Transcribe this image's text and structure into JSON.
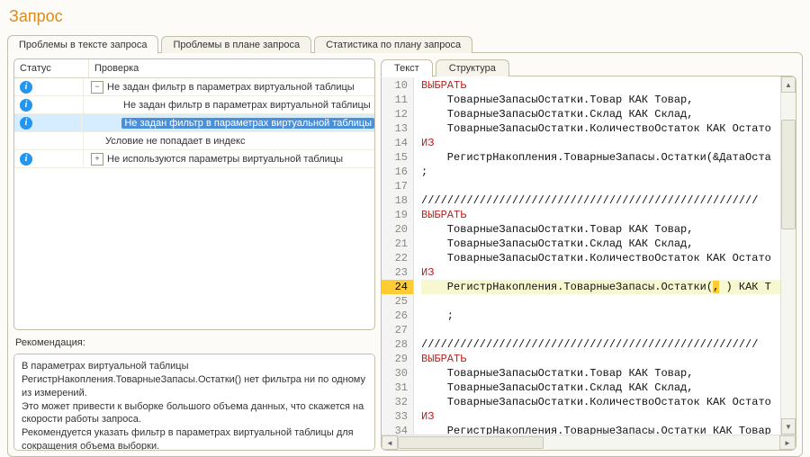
{
  "title": "Запрос",
  "main_tabs": [
    {
      "label": "Проблемы в тексте запроса",
      "active": true
    },
    {
      "label": "Проблемы в плане запроса",
      "active": false
    },
    {
      "label": "Статистика по плану запроса",
      "active": false
    }
  ],
  "tree": {
    "columns": {
      "status": "Статус",
      "check": "Проверка"
    },
    "rows": [
      {
        "icon": true,
        "indent": 0,
        "expander": "-",
        "label": "Не задан фильтр в параметрах виртуальной таблицы",
        "selected": false
      },
      {
        "icon": true,
        "indent": 1,
        "expander": "",
        "label": "Не задан фильтр в параметрах виртуальной таблицы",
        "selected": false
      },
      {
        "icon": true,
        "indent": 1,
        "expander": "",
        "label": "Не задан фильтр в параметрах виртуальной таблицы",
        "selected": true
      },
      {
        "icon": false,
        "indent": 0,
        "expander": "",
        "label": "Условие не попадает в индекс",
        "selected": false
      },
      {
        "icon": true,
        "indent": 0,
        "expander": "+",
        "label": "Не используются параметры виртуальной таблицы",
        "selected": false
      }
    ]
  },
  "recommendation_label": "Рекомендация:",
  "recommendation_text": "В параметрах виртуальной таблицы\nРегистрНакопления.ТоварныеЗапасы.Остатки() нет фильтра ни по одному из измерений.\nЭто может привести к выборке большого объема данных, что скажется на скорости работы запроса.\nРекомендуется указать фильтр в параметрах виртуальной таблицы для сокращения объема выборки.",
  "sub_tabs": [
    {
      "label": "Текст",
      "active": true
    },
    {
      "label": "Структура",
      "active": false
    }
  ],
  "code": {
    "first_line": 10,
    "highlight_line": 24,
    "lines": [
      {
        "n": 10,
        "t": "ВЫБРАТЬ",
        "kw": true
      },
      {
        "n": 11,
        "t": "    ТоварныеЗапасыОстатки.Товар КАК Товар,"
      },
      {
        "n": 12,
        "t": "    ТоварныеЗапасыОстатки.Склад КАК Склад,"
      },
      {
        "n": 13,
        "t": "    ТоварныеЗапасыОстатки.КоличествоОстаток КАК Остато"
      },
      {
        "n": 14,
        "t": "ИЗ",
        "kw": true
      },
      {
        "n": 15,
        "t": "    РегистрНакопления.ТоварныеЗапасы.Остатки(&ДатаОста"
      },
      {
        "n": 16,
        "t": ";"
      },
      {
        "n": 17,
        "t": ""
      },
      {
        "n": 18,
        "t": "////////////////////////////////////////////////////"
      },
      {
        "n": 19,
        "t": "ВЫБРАТЬ",
        "kw": true
      },
      {
        "n": 20,
        "t": "    ТоварныеЗапасыОстатки.Товар КАК Товар,"
      },
      {
        "n": 21,
        "t": "    ТоварныеЗапасыОстатки.Склад КАК Склад,"
      },
      {
        "n": 22,
        "t": "    ТоварныеЗапасыОстатки.КоличествоОстаток КАК Остато"
      },
      {
        "n": 23,
        "t": "ИЗ",
        "kw": true
      },
      {
        "n": 24,
        "t": "    РегистрНакопления.ТоварныеЗапасы.Остатки(, ) КАК Т",
        "hl": true,
        "hlspan": ","
      },
      {
        "n": 25,
        "t": ""
      },
      {
        "n": 26,
        "t": "    ;"
      },
      {
        "n": 27,
        "t": ""
      },
      {
        "n": 28,
        "t": "////////////////////////////////////////////////////"
      },
      {
        "n": 29,
        "t": "ВЫБРАТЬ",
        "kw": true
      },
      {
        "n": 30,
        "t": "    ТоварныеЗапасыОстатки.Товар КАК Товар,"
      },
      {
        "n": 31,
        "t": "    ТоварныеЗапасыОстатки.Склад КАК Склад,"
      },
      {
        "n": 32,
        "t": "    ТоварныеЗапасыОстатки.КоличествоОстаток КАК Остато"
      },
      {
        "n": 33,
        "t": "ИЗ",
        "kw": true
      },
      {
        "n": 34,
        "t": "    РегистрНакопления.ТоварныеЗапасы.Остатки КАК Товар"
      }
    ]
  }
}
